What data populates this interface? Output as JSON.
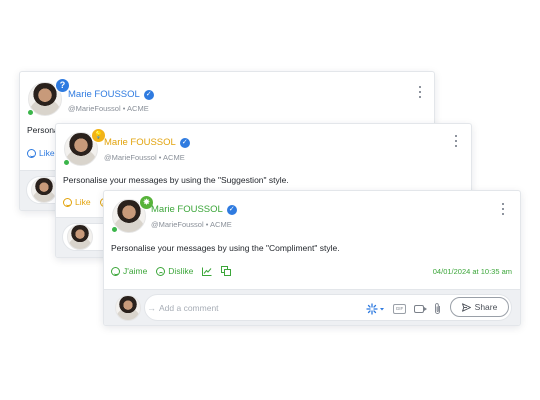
{
  "colors": {
    "link_blue": "#2f7be0",
    "suggestion_yellow": "#f2b317",
    "compliment_green": "#3ca63a",
    "online_green": "#3bb54a"
  },
  "posts": [
    {
      "author": "Marie FOUSSOL",
      "handle": "@MarieFoussol",
      "company": "ACME",
      "separator": "•",
      "badge": "?",
      "badge_icon": "question-icon",
      "message": "Personalise your messages by using the \"Question\" style.",
      "visible_message": "Personal",
      "actions": {
        "like": "Like"
      }
    },
    {
      "author": "Marie FOUSSOL",
      "handle": "@MarieFoussol",
      "company": "ACME",
      "separator": "•",
      "badge": "💡",
      "badge_icon": "lightbulb-icon",
      "message": "Personalise your messages by using the \"Suggestion\" style.",
      "actions": {
        "like": "Like"
      }
    },
    {
      "author": "Marie FOUSSOL",
      "handle": "@MarieFoussol",
      "company": "ACME",
      "separator": "•",
      "badge": "✸",
      "badge_icon": "sparkle-icon",
      "message": "Personalise your messages by using the \"Compliment\" style.",
      "actions": {
        "like": "J'aime",
        "dislike": "Dislike"
      },
      "timestamp": "04/01/2024 at 10:35 am"
    }
  ],
  "comment": {
    "placeholder": "Add a comment",
    "gif_label": "GIF",
    "share_label": "Share"
  }
}
